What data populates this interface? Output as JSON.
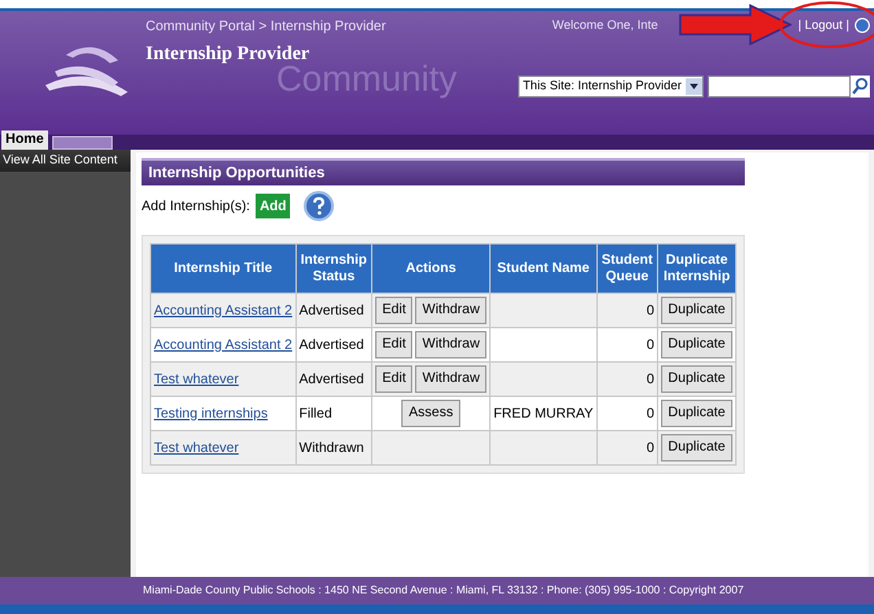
{
  "header": {
    "breadcrumb": "Community Portal > Internship Provider",
    "title": "Internship Provider",
    "brand_text": "Community",
    "welcome": "Welcome One, Inte",
    "logout": "| Logout |",
    "search_scope": "This Site: Internship Provider"
  },
  "tabs": [
    {
      "label": "Home",
      "selected": true
    },
    {
      "selected": false
    }
  ],
  "sidebar": {
    "items": [
      "View All Site Content"
    ]
  },
  "section": {
    "title": "Internship Opportunities",
    "add_label": "Add Internship(s):",
    "add_button": "Add"
  },
  "table": {
    "columns": [
      "Internship Title",
      "Internship Status",
      "Actions",
      "Student Name",
      "Student Queue",
      "Duplicate Internship"
    ],
    "rows": [
      {
        "title": "Accounting Assistant 2",
        "status": "Advertised",
        "kind": "edit_withdraw",
        "actions": [
          "Edit",
          "Withdraw"
        ],
        "student": "",
        "queue": "0",
        "duplicate": "Duplicate"
      },
      {
        "title": "Accounting Assistant 2",
        "status": "Advertised",
        "kind": "edit_withdraw",
        "actions": [
          "Edit",
          "Withdraw"
        ],
        "student": "",
        "queue": "0",
        "duplicate": "Duplicate"
      },
      {
        "title": "Test whatever",
        "status": "Advertised",
        "kind": "edit_withdraw",
        "actions": [
          "Edit",
          "Withdraw"
        ],
        "student": "",
        "queue": "0",
        "duplicate": "Duplicate"
      },
      {
        "title": "Testing internships",
        "status": "Filled",
        "kind": "assess",
        "actions": [
          "Assess"
        ],
        "student": "FRED MURRAY",
        "queue": "0",
        "duplicate": "Duplicate"
      },
      {
        "title": "Test whatever",
        "status": "Withdrawn",
        "kind": "none",
        "actions": [],
        "student": "",
        "queue": "0",
        "duplicate": "Duplicate"
      }
    ]
  },
  "footer": "Miami-Dade County Public Schools : 1450 NE Second Avenue : Miami, FL 33132 : Phone: (305) 995-1000 : Copyright 2007"
}
